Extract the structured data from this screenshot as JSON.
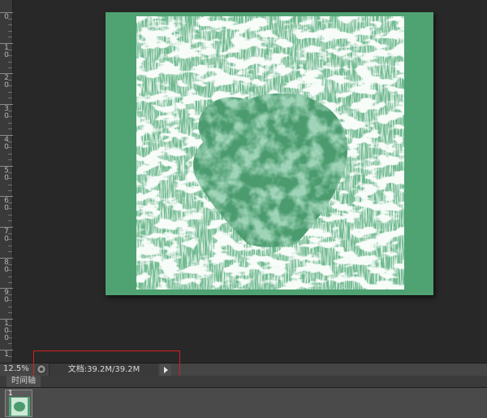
{
  "ruler": {
    "labels": [
      "0",
      "1\n0",
      "2\n0",
      "3\n0",
      "4\n0",
      "5\n0",
      "6\n0",
      "7\n0",
      "8\n0",
      "9\n0",
      "1\n0\n0",
      "1"
    ]
  },
  "canvas": {
    "image_description_colors": {
      "background": "#4fa272",
      "texture_light": "#e8f3ec",
      "heart": "#4b9b6e"
    }
  },
  "statusbar": {
    "zoom": "12.5%",
    "doc_info": "文档:39.2M/39.2M"
  },
  "timeline": {
    "tab_label": "时间轴",
    "frame_number": "1"
  },
  "colors": {
    "highlight_box": "#d42020",
    "app_bg": "#282828"
  }
}
